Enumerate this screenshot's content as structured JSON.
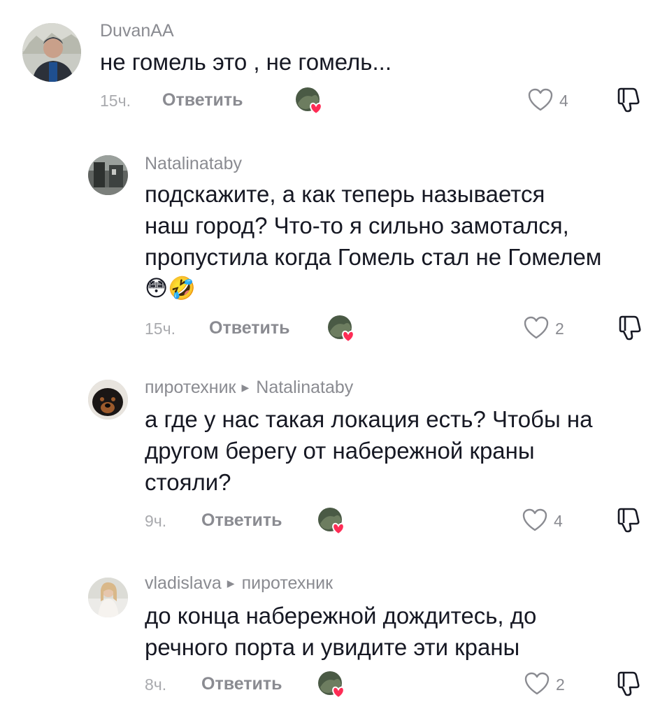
{
  "comments": [
    {
      "username": "DuvanAA",
      "reply_to": "",
      "lines": [
        "не гомель это , не гомель..."
      ],
      "time": "15ч.",
      "reply_label": "Ответить",
      "likes": "4"
    },
    {
      "username": "Natalinataby",
      "reply_to": "",
      "lines": [
        "подскажите, а как теперь называется",
        "наш город? Что-то я сильно замотался,",
        "пропустила когда Гомель стал не Гомелем",
        "😳🤣"
      ],
      "time": "15ч.",
      "reply_label": "Ответить",
      "likes": "2"
    },
    {
      "username": "пиротехник",
      "reply_to": "Natalinataby",
      "lines": [
        "а где у нас такая локация есть? Чтобы на",
        "другом берегу от набережной краны",
        "стояли?"
      ],
      "time": "9ч.",
      "reply_label": "Ответить",
      "likes": "4"
    },
    {
      "username": "vladislava",
      "reply_to": "пиротехник",
      "lines": [
        "до конца набережной дождитесь, до",
        "речного порта и увидите эти краны"
      ],
      "time": "8ч.",
      "reply_label": "Ответить",
      "likes": "2"
    }
  ],
  "icons": {
    "like": "heart-outline-icon",
    "dislike": "thumbs-down-icon",
    "creator_liked": "creator-liked-icon",
    "reply_arrow": "triangle-right-icon"
  },
  "colors": {
    "like_heart": "#fe2c55",
    "muted": "#8a8b91"
  }
}
